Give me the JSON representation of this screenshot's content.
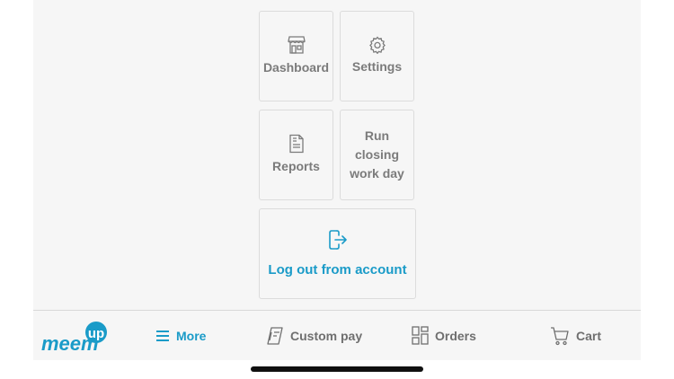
{
  "menu": {
    "dashboard": {
      "label": "Dashboard",
      "icon": "store-icon"
    },
    "settings": {
      "label": "Settings",
      "icon": "gear-icon"
    },
    "reports": {
      "label": "Reports",
      "icon": "document-icon"
    },
    "closing": {
      "label": "Run closing work day",
      "icon": ""
    },
    "logout": {
      "label": "Log out from account",
      "icon": "logout-icon"
    }
  },
  "brand": {
    "name": "meem",
    "badge": "up"
  },
  "nav": {
    "more": {
      "label": "More",
      "icon": "hamburger-icon"
    },
    "custom_pay": {
      "label": "Custom pay",
      "icon": "cash-register-icon"
    },
    "orders": {
      "label": "Orders",
      "icon": "grid-icon"
    },
    "cart": {
      "label": "Cart",
      "icon": "cart-icon"
    }
  },
  "colors": {
    "accent": "#1a9bc8",
    "background": "#f6f6f6",
    "text_muted": "#7b7b7b"
  }
}
